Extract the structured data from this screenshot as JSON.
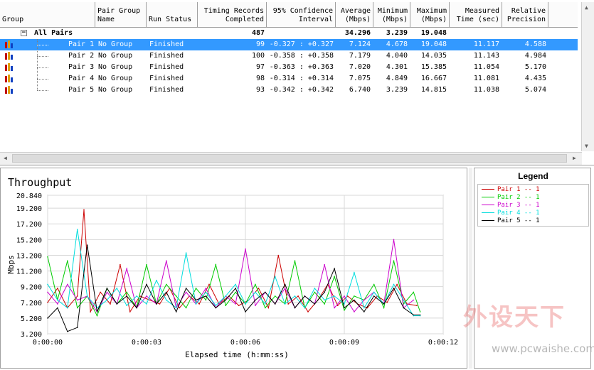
{
  "grid": {
    "columns": [
      {
        "key": "group",
        "label": "Group",
        "align": "left"
      },
      {
        "key": "pair_group_name",
        "label": "Pair Group\nName",
        "align": "left"
      },
      {
        "key": "run_status",
        "label": "Run Status",
        "align": "left"
      },
      {
        "key": "timing_records",
        "label": "Timing Records\nCompleted",
        "align": "right"
      },
      {
        "key": "confidence",
        "label": "95% Confidence\nInterval",
        "align": "right"
      },
      {
        "key": "average",
        "label": "Average\n(Mbps)",
        "align": "right"
      },
      {
        "key": "minimum",
        "label": "Minimum\n(Mbps)",
        "align": "right"
      },
      {
        "key": "maximum",
        "label": "Maximum\n(Mbps)",
        "align": "right"
      },
      {
        "key": "measured_time",
        "label": "Measured\nTime (sec)",
        "align": "right"
      },
      {
        "key": "relative_precision",
        "label": "Relative\nPrecision",
        "align": "right"
      }
    ],
    "summary": {
      "group": "All Pairs",
      "expander": "−",
      "timing_records": "487",
      "average": "34.296",
      "minimum": "3.239",
      "maximum": "19.048"
    },
    "rows": [
      {
        "pair": "Pair 1",
        "group_name": "No Group",
        "status": "Finished",
        "records": "99",
        "ci": "-0.327 : +0.327",
        "avg": "7.124",
        "min": "4.678",
        "max": "19.048",
        "time": "11.117",
        "precision": "4.588",
        "selected": true
      },
      {
        "pair": "Pair 2",
        "group_name": "No Group",
        "status": "Finished",
        "records": "100",
        "ci": "-0.358 : +0.358",
        "avg": "7.179",
        "min": "4.040",
        "max": "14.035",
        "time": "11.143",
        "precision": "4.984",
        "selected": false
      },
      {
        "pair": "Pair 3",
        "group_name": "No Group",
        "status": "Finished",
        "records": "97",
        "ci": "-0.363 : +0.363",
        "avg": "7.020",
        "min": "4.301",
        "max": "15.385",
        "time": "11.054",
        "precision": "5.170",
        "selected": false
      },
      {
        "pair": "Pair 4",
        "group_name": "No Group",
        "status": "Finished",
        "records": "98",
        "ci": "-0.314 : +0.314",
        "avg": "7.075",
        "min": "4.849",
        "max": "16.667",
        "time": "11.081",
        "precision": "4.435",
        "selected": false
      },
      {
        "pair": "Pair 5",
        "group_name": "No Group",
        "status": "Finished",
        "records": "93",
        "ci": "-0.342 : +0.342",
        "avg": "6.740",
        "min": "3.239",
        "max": "14.815",
        "time": "11.038",
        "precision": "5.074",
        "selected": false
      }
    ]
  },
  "legend": {
    "title": "Legend",
    "items": [
      {
        "label": "Pair 1 -- 1",
        "color": "#cc0000"
      },
      {
        "label": "Pair 2 -- 1",
        "color": "#00cc00"
      },
      {
        "label": "Pair 3 -- 1",
        "color": "#cc00cc"
      },
      {
        "label": "Pair 4 -- 1",
        "color": "#00dddd"
      },
      {
        "label": "Pair 5 -- 1",
        "color": "#000000"
      }
    ]
  },
  "watermark": {
    "brand": "外设天下",
    "url": "www.pcwaishe.com"
  },
  "chart_data": {
    "type": "line",
    "title": "Throughput",
    "xlabel": "Elapsed time (h:mm:ss)",
    "ylabel": "Mbps",
    "xlim": [
      0,
      12
    ],
    "ylim": [
      3.2,
      20.84
    ],
    "x_ticks": [
      "0:00:00",
      "0:00:03",
      "0:00:06",
      "0:00:09",
      "0:00:12"
    ],
    "y_ticks": [
      "20.840",
      "19.200",
      "17.200",
      "15.200",
      "13.200",
      "11.200",
      "9.200",
      "7.200",
      "5.200",
      "3.200"
    ],
    "grid": true,
    "series": [
      {
        "name": "Pair 1 -- 1",
        "color": "#cc0000",
        "x": [
          0,
          0.3,
          0.6,
          0.9,
          1.1,
          1.3,
          1.6,
          1.9,
          2.2,
          2.5,
          2.8,
          3.1,
          3.4,
          3.7,
          4.0,
          4.3,
          4.6,
          4.9,
          5.2,
          5.5,
          5.8,
          6.1,
          6.4,
          6.7,
          7.0,
          7.3,
          7.6,
          7.9,
          8.2,
          8.5,
          8.8,
          9.1,
          9.4,
          9.7,
          10.0,
          10.3,
          10.6,
          10.9,
          11.2
        ],
        "y": [
          7.2,
          9.0,
          6.5,
          8.0,
          19.0,
          6.0,
          8.5,
          7.0,
          12.0,
          6.0,
          8.0,
          7.5,
          7.0,
          9.0,
          6.5,
          8.0,
          7.0,
          9.5,
          7.0,
          8.0,
          6.8,
          7.5,
          9.0,
          6.5,
          13.2,
          7.0,
          8.0,
          6.0,
          7.5,
          9.5,
          6.8,
          8.0,
          7.0,
          6.5,
          8.0,
          7.2,
          9.5,
          7.0,
          6.8
        ]
      },
      {
        "name": "Pair 2 -- 1",
        "color": "#00cc00",
        "x": [
          0,
          0.3,
          0.6,
          0.9,
          1.2,
          1.5,
          1.8,
          2.1,
          2.4,
          2.7,
          3.0,
          3.3,
          3.6,
          3.9,
          4.2,
          4.5,
          4.8,
          5.1,
          5.4,
          5.7,
          6.0,
          6.3,
          6.6,
          6.9,
          7.2,
          7.5,
          7.8,
          8.1,
          8.4,
          8.7,
          9.0,
          9.3,
          9.6,
          9.9,
          10.2,
          10.5,
          10.8,
          11.1,
          11.3
        ],
        "y": [
          13.0,
          7.5,
          12.5,
          6.5,
          8.0,
          5.5,
          9.0,
          7.0,
          8.5,
          6.5,
          12.0,
          7.0,
          9.5,
          8.0,
          6.5,
          9.0,
          7.5,
          12.0,
          6.8,
          8.5,
          7.0,
          9.5,
          6.5,
          8.0,
          7.0,
          12.5,
          6.5,
          8.5,
          7.0,
          10.5,
          6.2,
          8.0,
          7.5,
          9.5,
          6.5,
          12.5,
          7.0,
          8.5,
          6.0
        ]
      },
      {
        "name": "Pair 3 -- 1",
        "color": "#cc00cc",
        "x": [
          0,
          0.3,
          0.6,
          0.9,
          1.2,
          1.5,
          1.8,
          2.1,
          2.4,
          2.7,
          3.0,
          3.3,
          3.6,
          3.9,
          4.2,
          4.5,
          4.8,
          5.1,
          5.4,
          5.7,
          6.0,
          6.3,
          6.6,
          6.9,
          7.2,
          7.5,
          7.8,
          8.1,
          8.4,
          8.7,
          9.0,
          9.3,
          9.6,
          9.9,
          10.2,
          10.5,
          10.8,
          11.1
        ],
        "y": [
          8.5,
          7.0,
          9.5,
          7.5,
          8.0,
          6.0,
          8.5,
          7.0,
          11.5,
          6.5,
          8.0,
          7.0,
          12.5,
          6.5,
          8.5,
          7.0,
          9.0,
          6.5,
          8.0,
          7.0,
          14.0,
          6.8,
          8.5,
          7.0,
          9.0,
          6.5,
          8.0,
          7.0,
          12.0,
          6.5,
          8.0,
          6.0,
          7.5,
          8.5,
          7.0,
          15.2,
          6.5,
          7.5
        ]
      },
      {
        "name": "Pair 4 -- 1",
        "color": "#00dddd",
        "x": [
          0,
          0.3,
          0.6,
          0.9,
          1.2,
          1.5,
          1.8,
          2.1,
          2.4,
          2.7,
          3.0,
          3.3,
          3.6,
          3.9,
          4.2,
          4.5,
          4.8,
          5.1,
          5.4,
          5.7,
          6.0,
          6.3,
          6.6,
          6.9,
          7.2,
          7.5,
          7.8,
          8.1,
          8.4,
          8.7,
          9.0,
          9.3,
          9.6,
          9.9,
          10.2,
          10.5,
          10.8,
          11.1,
          11.3
        ],
        "y": [
          9.5,
          7.5,
          6.5,
          16.5,
          8.0,
          6.5,
          7.5,
          9.0,
          6.8,
          8.0,
          7.0,
          10.0,
          7.5,
          6.5,
          13.5,
          7.0,
          8.5,
          6.8,
          8.0,
          9.5,
          7.0,
          8.5,
          7.0,
          10.5,
          7.0,
          8.0,
          6.5,
          9.0,
          7.5,
          8.0,
          7.0,
          11.0,
          6.5,
          8.5,
          7.0,
          9.5,
          7.5,
          5.5,
          5.5
        ]
      },
      {
        "name": "Pair 5 -- 1",
        "color": "#000000",
        "x": [
          0,
          0.3,
          0.6,
          0.9,
          1.2,
          1.5,
          1.8,
          2.1,
          2.4,
          2.7,
          3.0,
          3.3,
          3.6,
          3.9,
          4.2,
          4.5,
          4.8,
          5.1,
          5.4,
          5.7,
          6.0,
          6.3,
          6.6,
          6.9,
          7.2,
          7.5,
          7.8,
          8.1,
          8.4,
          8.7,
          9.0,
          9.3,
          9.6,
          9.9,
          10.2,
          10.5,
          10.8,
          11.1,
          11.3
        ],
        "y": [
          5.2,
          6.5,
          3.5,
          4.0,
          14.5,
          6.0,
          9.0,
          7.0,
          8.0,
          6.5,
          9.5,
          7.0,
          8.5,
          6.0,
          9.0,
          7.5,
          8.0,
          6.5,
          7.5,
          9.0,
          6.0,
          7.5,
          8.5,
          7.0,
          9.5,
          6.5,
          8.0,
          7.0,
          8.5,
          11.5,
          6.5,
          7.5,
          6.0,
          8.0,
          7.0,
          9.0,
          6.5,
          5.6,
          5.6
        ]
      }
    ]
  }
}
